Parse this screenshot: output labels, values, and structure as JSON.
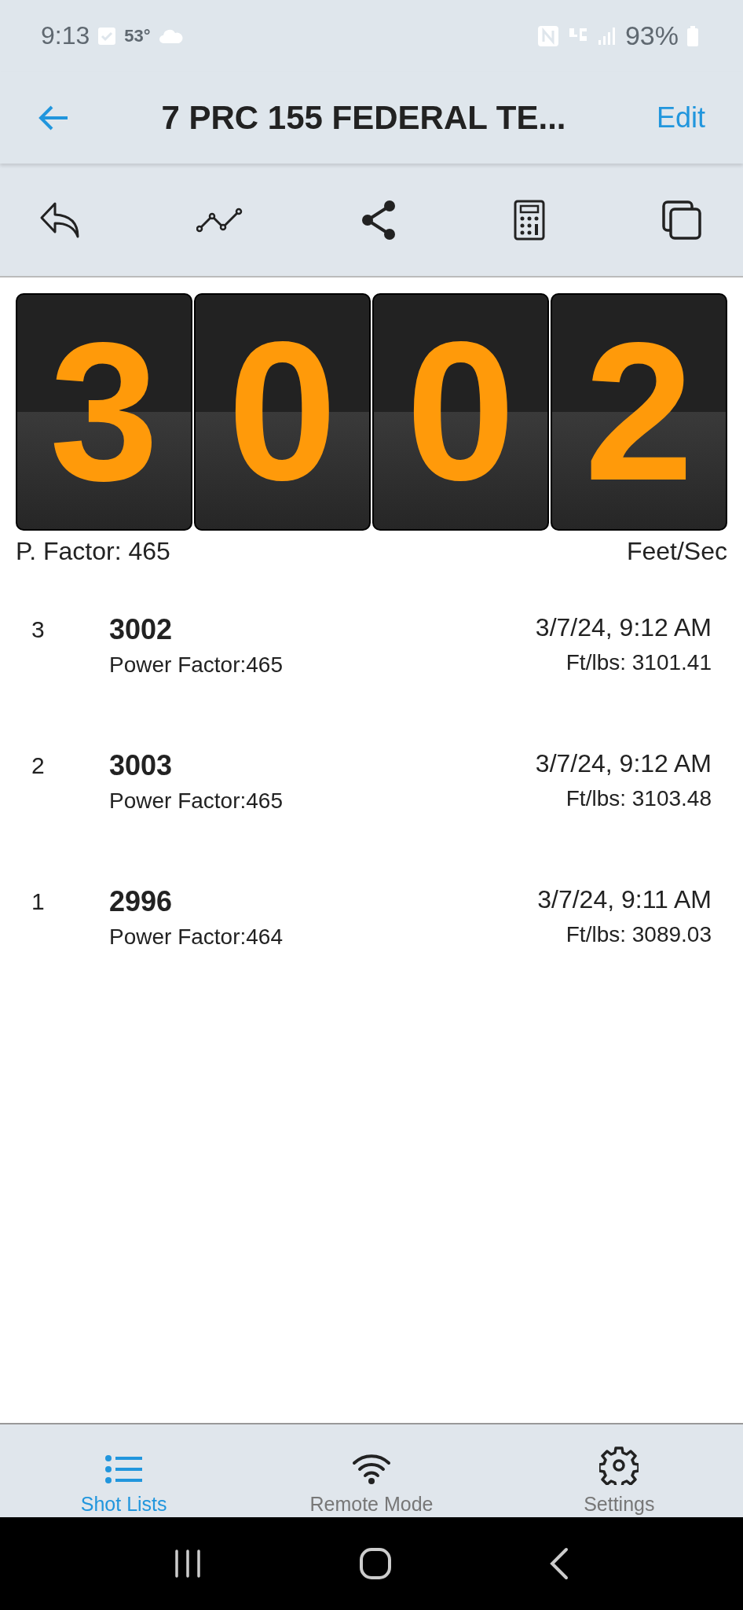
{
  "status_bar": {
    "time": "9:13",
    "temperature": "53°",
    "battery": "93%"
  },
  "app_bar": {
    "title": "7 PRC 155 FEDERAL TE...",
    "action": "Edit"
  },
  "display": {
    "digits": [
      "3",
      "0",
      "0",
      "2"
    ],
    "power_factor": "P. Factor: 465",
    "unit": "Feet/Sec"
  },
  "shots": [
    {
      "number": "3",
      "speed": "3002",
      "power_factor": "Power Factor:465",
      "time": "3/7/24, 9:12 AM",
      "energy": "Ft/lbs: 3101.41"
    },
    {
      "number": "2",
      "speed": "3003",
      "power_factor": "Power Factor:465",
      "time": "3/7/24, 9:12 AM",
      "energy": "Ft/lbs: 3103.48"
    },
    {
      "number": "1",
      "speed": "2996",
      "power_factor": "Power Factor:464",
      "time": "3/7/24, 9:11 AM",
      "energy": "Ft/lbs: 3089.03"
    }
  ],
  "tabs": [
    {
      "label": "Shot Lists",
      "kind": "list",
      "selected": true
    },
    {
      "label": "Remote Mode",
      "kind": "wifi",
      "selected": false
    },
    {
      "label": "Settings",
      "kind": "gear",
      "selected": false
    }
  ]
}
